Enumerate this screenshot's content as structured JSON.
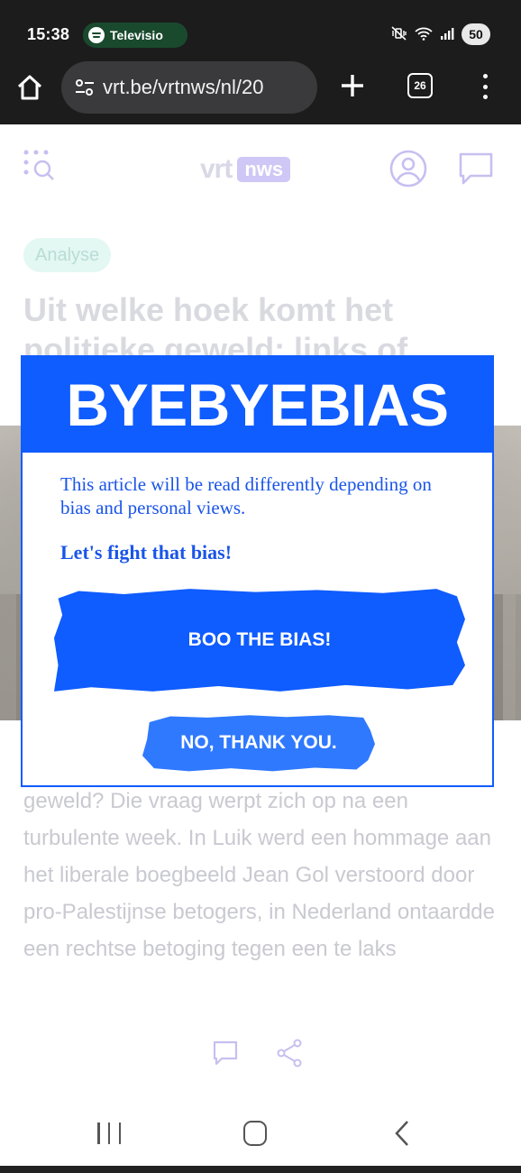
{
  "status_bar": {
    "time": "15:38",
    "media_app": "Televisio",
    "battery": "50",
    "mute_icon": "vibrate-mute-icon",
    "wifi_icon": "wifi-icon",
    "signal_icon": "signal-icon"
  },
  "browser": {
    "url": "vrt.be/vrtnws/nl/20",
    "tab_count": "26",
    "home_icon": "home-icon",
    "new_tab_icon": "plus-icon",
    "menu_icon": "three-dot-menu-icon"
  },
  "site": {
    "logo_word": "vrt",
    "logo_badge": "nws",
    "colors": {
      "badge": "#cfc7f5",
      "icons": "#c7bff0"
    }
  },
  "article": {
    "category": "Analyse",
    "title": "Uit welke hoek komt het politieke geweld: links of",
    "body": "geweld? Die vraag werpt zich op na een turbulente week. In Luik werd een hommage aan het liberale boegbeeld Jean Gol verstoord door pro-Palestijnse betogers, in Nederland ontaardde een rechtse betoging tegen een te laks"
  },
  "modal": {
    "title": "BYEBYEBIAS",
    "text": "This article will be read differently depending on bias and personal views.",
    "cta_text": "Let's fight that bias!",
    "primary_button": "BOO THE BIAS!",
    "secondary_button": "NO, THANK YOU.",
    "colors": {
      "primary": "#0f5cff",
      "secondary": "#2f79ff",
      "text": "#1a55e8"
    }
  }
}
